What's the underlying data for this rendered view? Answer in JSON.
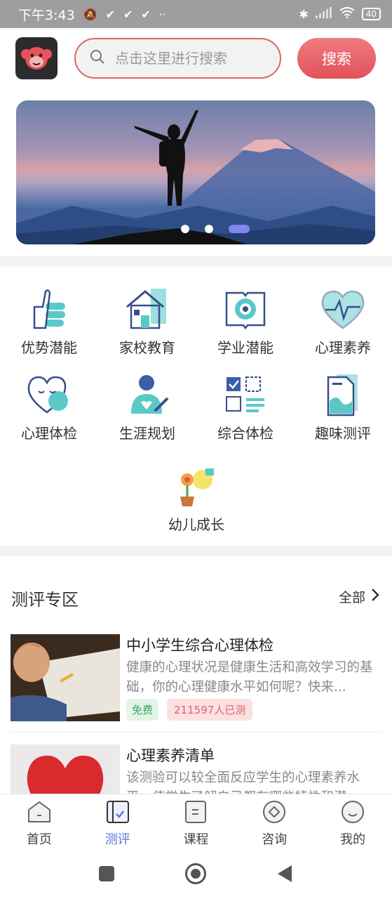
{
  "status_bar": {
    "time": "下午3:43",
    "battery": "40"
  },
  "header": {
    "search_placeholder": "点击这里进行搜索",
    "search_button": "搜索"
  },
  "banner": {
    "page_count": 3,
    "active_index": 2
  },
  "categories": [
    {
      "label": "优势潜能",
      "icon": "thumbs-up-icon"
    },
    {
      "label": "家校教育",
      "icon": "house-icon"
    },
    {
      "label": "学业潜能",
      "icon": "book-target-icon"
    },
    {
      "label": "心理素养",
      "icon": "heart-pulse-icon"
    },
    {
      "label": "心理体检",
      "icon": "heart-chat-icon"
    },
    {
      "label": "生涯规划",
      "icon": "person-pen-icon"
    },
    {
      "label": "综合体检",
      "icon": "checklist-icon"
    },
    {
      "label": "趣味测评",
      "icon": "document-icon"
    },
    {
      "label": "幼儿成长",
      "icon": "flower-watering-icon"
    }
  ],
  "assessment_section": {
    "title": "测评专区",
    "all_label": "全部",
    "items": [
      {
        "title": "中小学生综合心理体检",
        "description": "健康的心理状况是健康生活和高效学习的基础，你的心理健康水平如何呢？快来...",
        "tag_free": "免费",
        "tag_count": "211597人已测"
      },
      {
        "title": "心理素养清单",
        "description": "该测验可以较全面反应学生的心理素养水平，使学生了解自己都有哪些特性和潜"
      }
    ]
  },
  "tab_bar": {
    "tabs": [
      {
        "label": "首页",
        "icon": "home-icon"
      },
      {
        "label": "测评",
        "icon": "assessment-icon",
        "active": true
      },
      {
        "label": "课程",
        "icon": "course-icon"
      },
      {
        "label": "咨询",
        "icon": "consult-icon"
      },
      {
        "label": "我的",
        "icon": "profile-icon"
      }
    ]
  },
  "colors": {
    "accent": "#e06268",
    "tab_active": "#5e73de",
    "icon_teal": "#5bc8c8",
    "icon_navy": "#3a4e8a"
  }
}
